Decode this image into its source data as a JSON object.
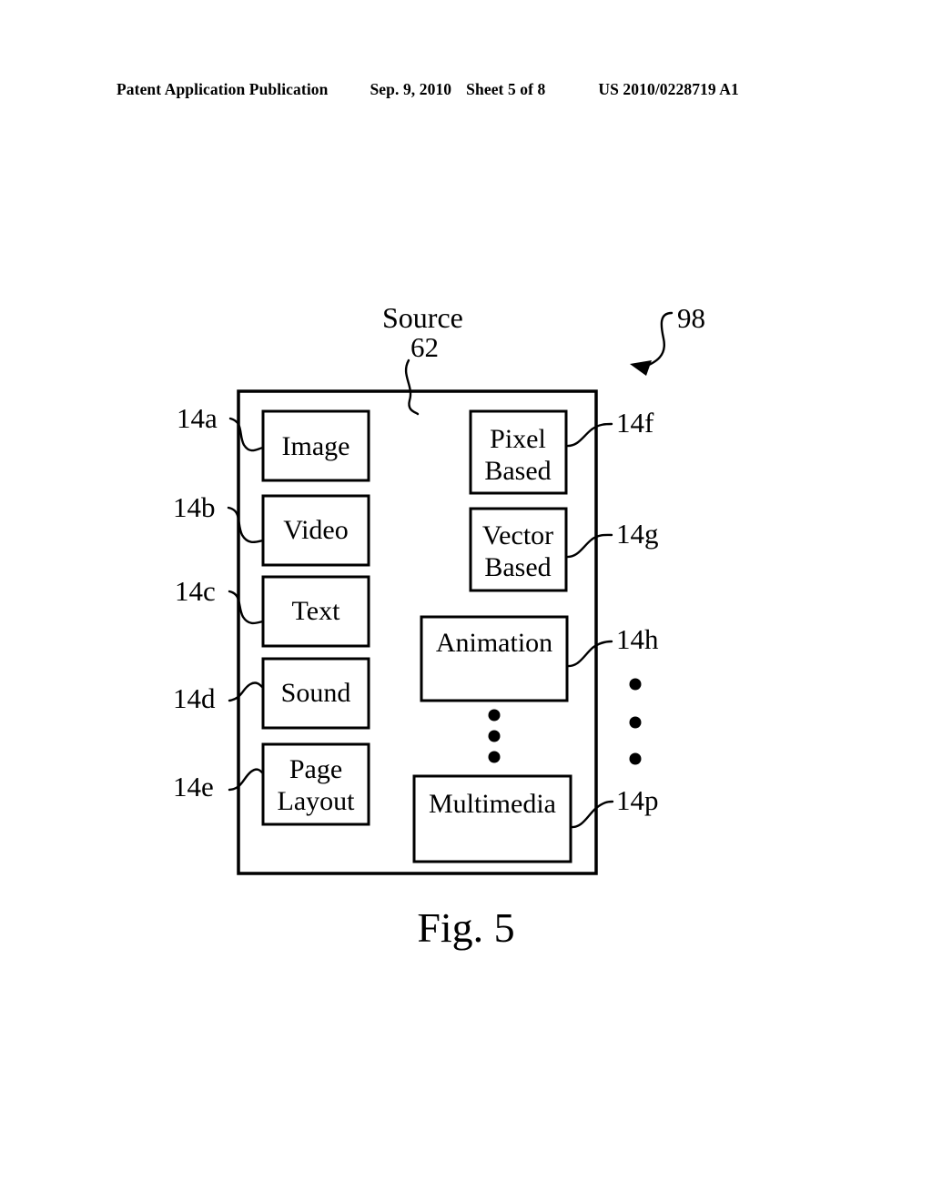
{
  "header": {
    "publication": "Patent Application Publication",
    "date": "Sep. 9, 2010",
    "sheet": "Sheet 5 of 8",
    "patent_number": "US 2010/0228719 A1"
  },
  "figure": {
    "caption": "Fig. 5",
    "diagram_reference": "98",
    "container": {
      "title": "Source",
      "reference": "62"
    },
    "left_column": [
      {
        "ref": "14a",
        "label": "Image",
        "lines": [
          "Image"
        ]
      },
      {
        "ref": "14b",
        "label": "Video",
        "lines": [
          "Video"
        ]
      },
      {
        "ref": "14c",
        "label": "Text",
        "lines": [
          "Text"
        ]
      },
      {
        "ref": "14d",
        "label": "Sound",
        "lines": [
          "Sound"
        ]
      },
      {
        "ref": "14e",
        "label": "Page Layout",
        "lines": [
          "Page",
          "Layout"
        ]
      }
    ],
    "right_column": [
      {
        "ref": "14f",
        "label": "Pixel Based",
        "lines": [
          "Pixel",
          "Based"
        ]
      },
      {
        "ref": "14g",
        "label": "Vector Based",
        "lines": [
          "Vector",
          "Based"
        ]
      },
      {
        "ref": "14h",
        "label": "Animation",
        "lines": [
          "Animation"
        ]
      },
      {
        "ref": "14p",
        "label": "Multimedia",
        "lines": [
          "Multimedia"
        ]
      }
    ],
    "ellipsis_inner": "⋮",
    "ellipsis_outer": "⋮"
  },
  "colors": {
    "ink": "#000000",
    "paper": "#ffffff"
  }
}
